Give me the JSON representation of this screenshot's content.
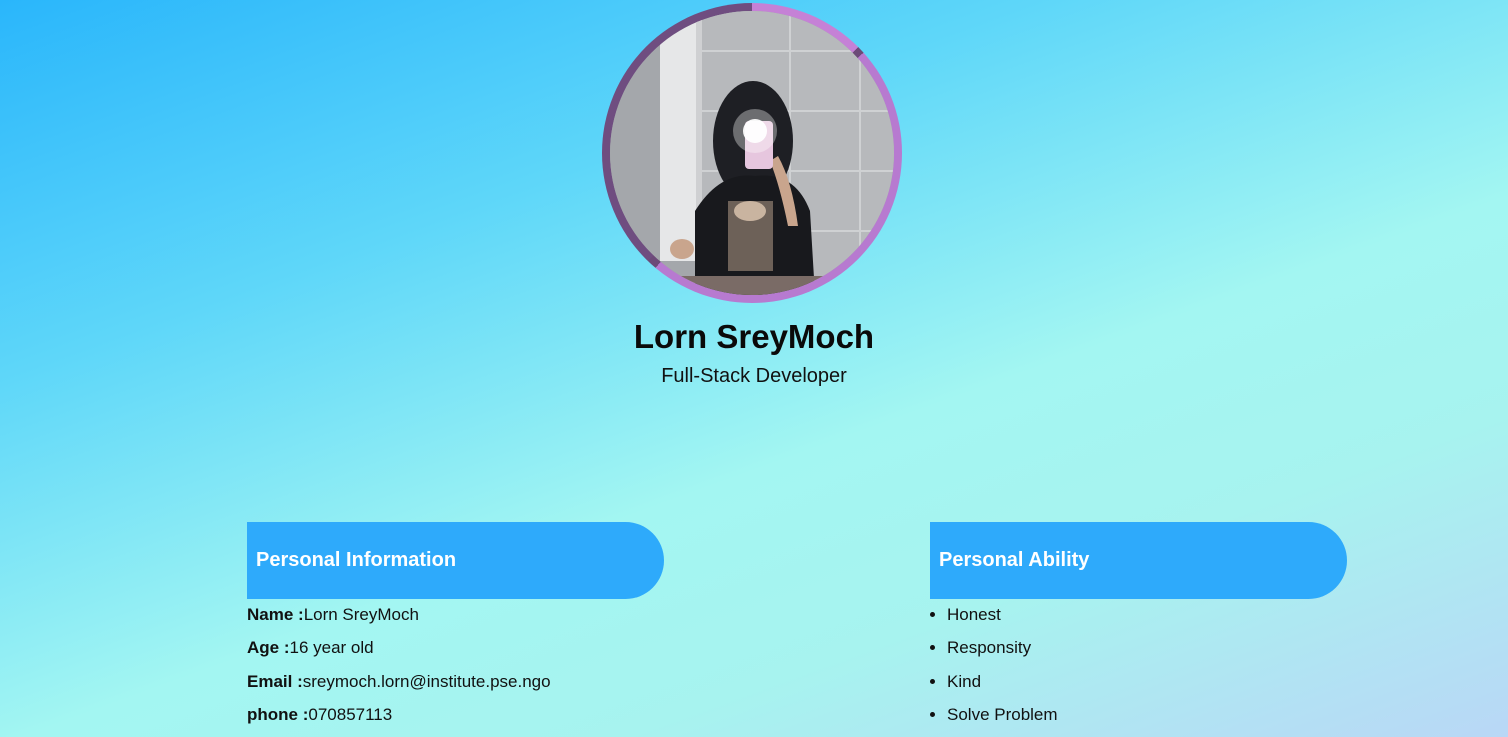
{
  "profile": {
    "name": "Lorn SreyMoch",
    "role": "Full-Stack Developer"
  },
  "personal_information": {
    "title": "Personal Information",
    "items": [
      {
        "label": "Name :",
        "value": "Lorn SreyMoch"
      },
      {
        "label": "Age :",
        "value": "16 year old"
      },
      {
        "label": "Email :",
        "value": "sreymoch.lorn@institute.pse.ngo"
      },
      {
        "label": "phone :",
        "value": "070857113"
      }
    ]
  },
  "personal_ability": {
    "title": "Personal Ability",
    "items": [
      "Honest",
      "Responsity",
      "Kind",
      "Solve Problem"
    ]
  },
  "colors": {
    "header_bg": "#2eaafb",
    "ring": "#b77ad0"
  }
}
